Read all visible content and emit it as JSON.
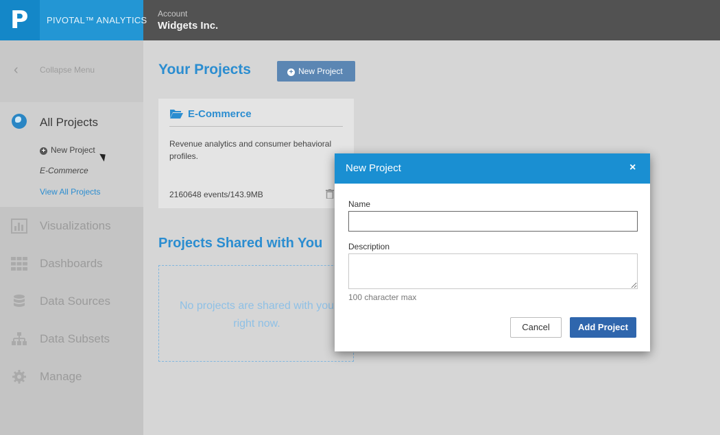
{
  "brand": {
    "logo_letter": "P",
    "name": "PIVOTAL™ ANALYTICS"
  },
  "account": {
    "label": "Account",
    "name": "Widgets Inc."
  },
  "sidebar": {
    "collapse_label": "Collapse Menu",
    "all_projects": {
      "label": "All Projects",
      "new_project": "New Project",
      "recent_project": "E-Commerce",
      "view_all": "View All Projects"
    },
    "items": [
      {
        "label": "Visualizations",
        "icon": "bar-chart-icon"
      },
      {
        "label": "Dashboards",
        "icon": "grid-icon"
      },
      {
        "label": "Data Sources",
        "icon": "database-icon"
      },
      {
        "label": "Data Subsets",
        "icon": "sitemap-icon"
      },
      {
        "label": "Manage",
        "icon": "gear-icon"
      }
    ]
  },
  "main": {
    "title": "Your Projects",
    "new_project_button": "New Project",
    "project_card": {
      "title": "E-Commerce",
      "description": "Revenue analytics and consumer behavioral profiles.",
      "stats": "2160648 events/143.9MB"
    },
    "shared_title": "Projects Shared with You",
    "shared_empty": "No projects are shared with you right now."
  },
  "modal": {
    "title": "New Project",
    "close": "×",
    "name_label": "Name",
    "name_value": "",
    "description_label": "Description",
    "description_value": "",
    "hint": "100 character max",
    "cancel": "Cancel",
    "submit": "Add Project"
  },
  "colors": {
    "accent": "#1a8fd2",
    "primary_button": "#2f66ad",
    "topbar": "#525252"
  }
}
